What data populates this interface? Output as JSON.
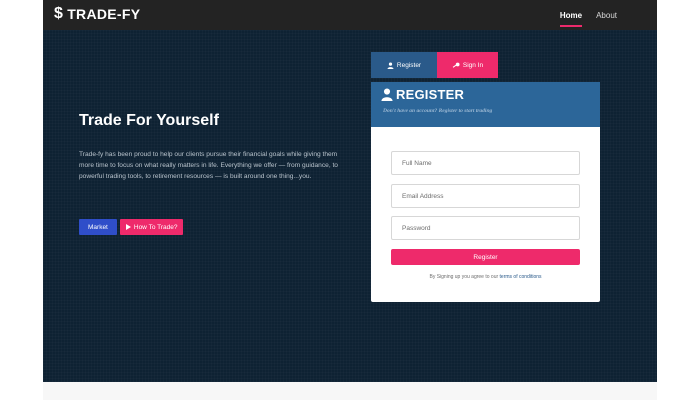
{
  "navbar": {
    "brand_symbol": "$",
    "brand_name": "TRADE-FY",
    "links": [
      {
        "label": "Home",
        "active": true
      },
      {
        "label": "About",
        "active": false
      }
    ]
  },
  "hero": {
    "title": "Trade For Yourself",
    "text": "Trade-fy has been proud to help our clients pursue their financial goals while giving them more time to focus on what really matters in life. Everything we offer — from guidance, to powerful trading tools, to retirement resources — is built around one thing...you.",
    "buttons": {
      "market": "Market",
      "how_to_trade": "How To Trade?"
    }
  },
  "auth": {
    "tabs": {
      "register": "Register",
      "signin": "Sign In"
    },
    "card": {
      "title": "REGISTER",
      "subtitle": "Don't have an account? Register to start trading",
      "fields": {
        "full_name_placeholder": "Full Name",
        "email_placeholder": "Email Address",
        "password_placeholder": "Password"
      },
      "submit_label": "Register",
      "terms_prefix": "By Signing up you agree to our",
      "terms_link": "terms of conditions"
    }
  },
  "colors": {
    "navbar_bg": "#232323",
    "hero_bg": "#0e2233",
    "accent_pink": "#ee2a6b",
    "accent_blue": "#2f4ec9",
    "card_header": "#2c6699"
  },
  "icons": {
    "tab_register": "user-icon",
    "tab_signin": "key-icon",
    "card_title": "user-icon",
    "how_to_trade": "play-icon"
  }
}
